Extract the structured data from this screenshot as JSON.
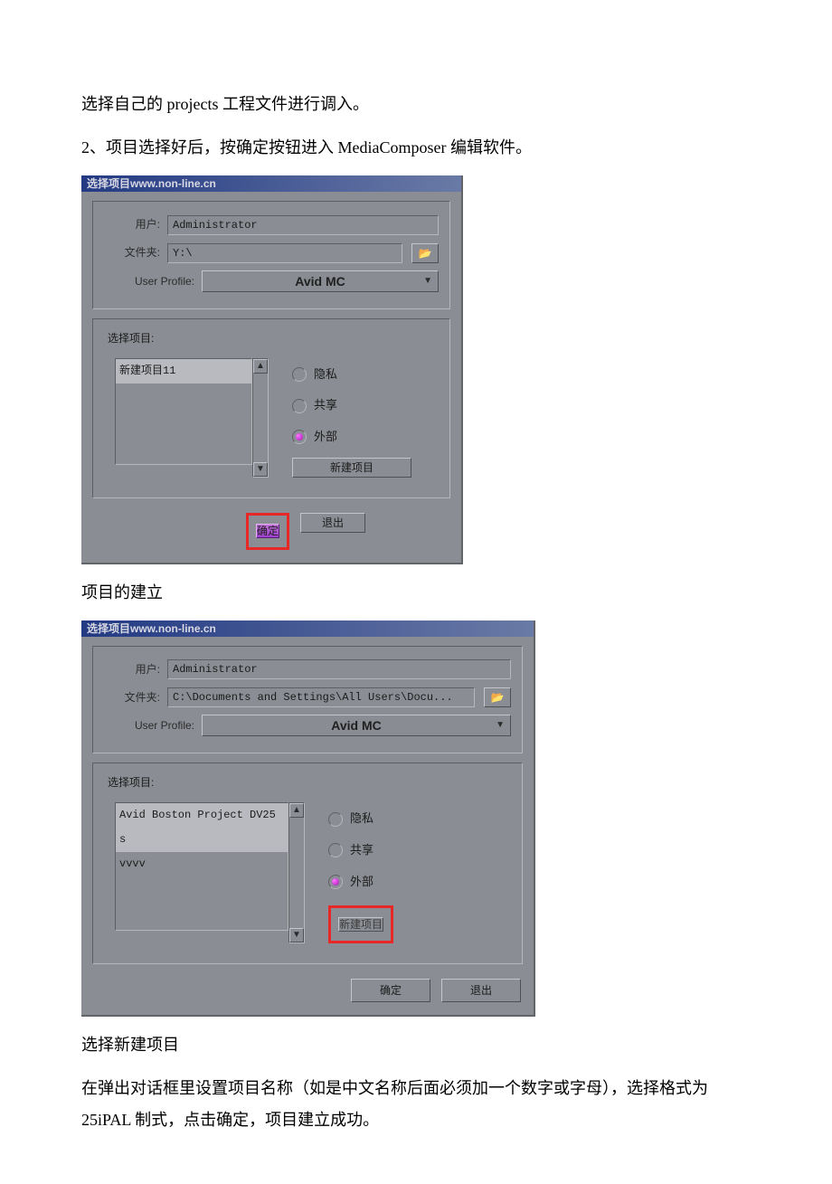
{
  "doc": {
    "line1": "选择自己的 projects 工程文件进行调入。",
    "line2": "2、项目选择好后，按确定按钮进入 MediaComposer 编辑软件。",
    "line3": "项目的建立",
    "line4": "选择新建项目",
    "line5": "在弹出对话框里设置项目名称（如是中文名称后面必须加一个数字或字母），选择格式为 25iPAL 制式，点击确定，项目建立成功。"
  },
  "dialog1": {
    "title": "选择项目www.non-line.cn",
    "user_label": "用户:",
    "user_value": "Administrator",
    "folder_label": "文件夹:",
    "folder_value": "Y:\\",
    "profile_label": "User Profile:",
    "profile_value": "Avid MC",
    "select_label": "选择项目:",
    "list": [
      "新建项目11"
    ],
    "radios": {
      "private": "隐私",
      "shared": "共享",
      "external": "外部",
      "selected": "external"
    },
    "new_project": "新建项目",
    "ok": "确定",
    "exit": "退出"
  },
  "dialog2": {
    "title": "选择项目www.non-line.cn",
    "user_label": "用户:",
    "user_value": "Administrator",
    "folder_label": "文件夹:",
    "folder_value": "C:\\Documents and Settings\\All Users\\Docu...",
    "profile_label": "User Profile:",
    "profile_value": "Avid MC",
    "select_label": "选择项目:",
    "list": [
      "Avid Boston Project DV25",
      "s",
      "vvvv"
    ],
    "radios": {
      "private": "隐私",
      "shared": "共享",
      "external": "外部",
      "selected": "external"
    },
    "new_project": "新建项目",
    "ok": "确定",
    "exit": "退出"
  },
  "icons": {
    "folder": "📂",
    "arrow_down": "▼",
    "arrow_up": "▲"
  }
}
